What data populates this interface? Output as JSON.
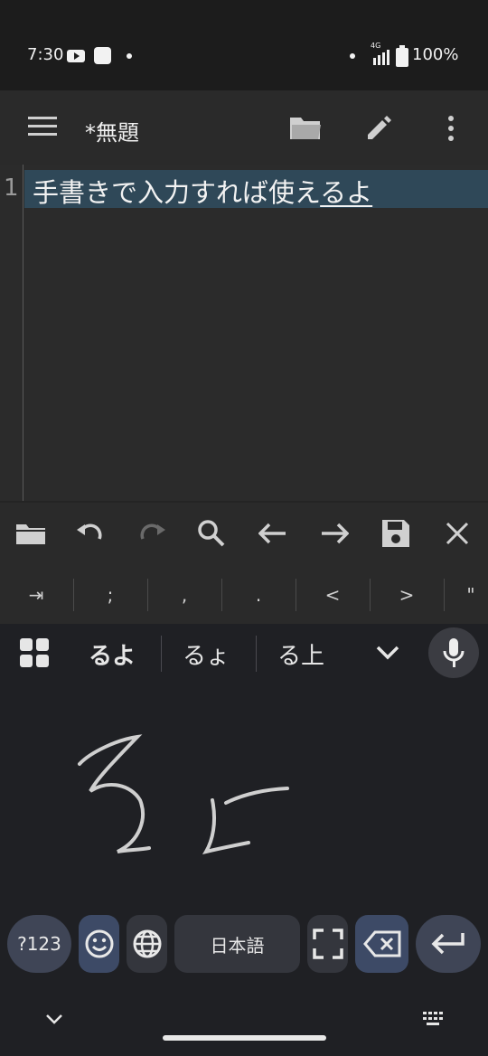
{
  "status_bar": {
    "time": "7:30",
    "network": "4G",
    "battery": "100%"
  },
  "toolbar": {
    "title": "*無題"
  },
  "editor": {
    "line_number": "1",
    "line_committed": "手書きで入力すれば使え",
    "line_composing": "るよ",
    "highlight_color": "#2f4858"
  },
  "symbols": [
    "⇥",
    ";",
    ",",
    ".",
    "<",
    ">",
    "\""
  ],
  "keyboard": {
    "candidates": [
      "るよ",
      "るょ",
      "る上"
    ],
    "keys": {
      "symbols": "?123",
      "language": "日本語"
    },
    "accent": "#3d4a66"
  },
  "icons": [
    "menu-icon",
    "folder-open-icon",
    "pencil-icon",
    "more-vert-icon",
    "folder-icon",
    "undo-icon",
    "redo-icon",
    "search-icon",
    "arrow-left-icon",
    "arrow-right-icon",
    "save-icon",
    "close-icon",
    "grid-icon",
    "chevron-down-icon",
    "mic-icon",
    "emoji-icon",
    "globe-icon",
    "fullscreen-icon",
    "backspace-icon",
    "enter-icon",
    "keyboard-icon"
  ]
}
